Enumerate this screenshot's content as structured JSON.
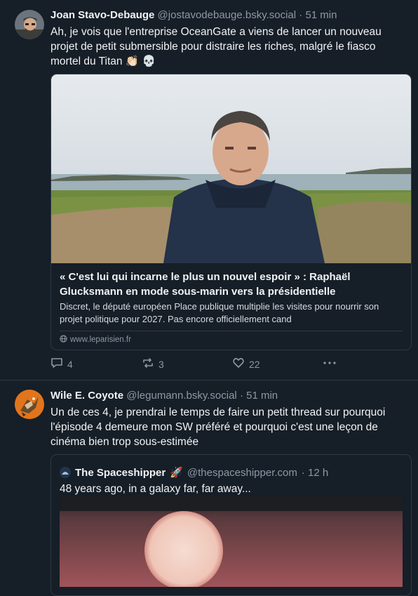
{
  "posts": [
    {
      "author_name": "Joan Stavo-Debauge",
      "handle": "@jostavodebauge.bsky.social",
      "time": "· 51 min",
      "text": "Ah, je vois que l'entreprise OceanGate a viens de lancer un nouveau projet de petit submersible pour distraire les riches, malgré le fiasco mortel du Titan",
      "emojis": [
        "👏🏻",
        "💀"
      ],
      "link_card": {
        "title": "« C'est lui qui incarne le plus un nouvel espoir » : Raphaël Glucksmann en mode sous-marin vers la présidentielle",
        "description": "Discret, le député européen Place publique multiplie les visites pour nourrir son projet politique pour 2027. Pas encore officiellement cand",
        "domain": "www.leparisien.fr"
      },
      "actions": {
        "replies": "4",
        "reposts": "3",
        "likes": "22"
      }
    },
    {
      "author_name": "Wile E. Coyote",
      "handle": "@legumann.bsky.social",
      "time": "· 51 min",
      "text": "Un de ces 4, je prendrai le temps de faire un petit thread sur pourquoi l'épisode 4 demeure mon SW préféré et pourquoi c'est une leçon de cinéma bien trop sous-estimée",
      "quote": {
        "author_name": "The Spaceshipper",
        "emoji": "🚀",
        "handle": "@thespaceshipper.com",
        "time": "· 12 h",
        "text": "48 years ago, in a galaxy far, far away..."
      }
    }
  ],
  "colors": {
    "background": "#161e27",
    "muted": "#8d99a6",
    "border": "#2e3a47"
  },
  "icons": [
    "reply-icon",
    "repost-icon",
    "like-icon",
    "more-icon",
    "globe-icon"
  ]
}
